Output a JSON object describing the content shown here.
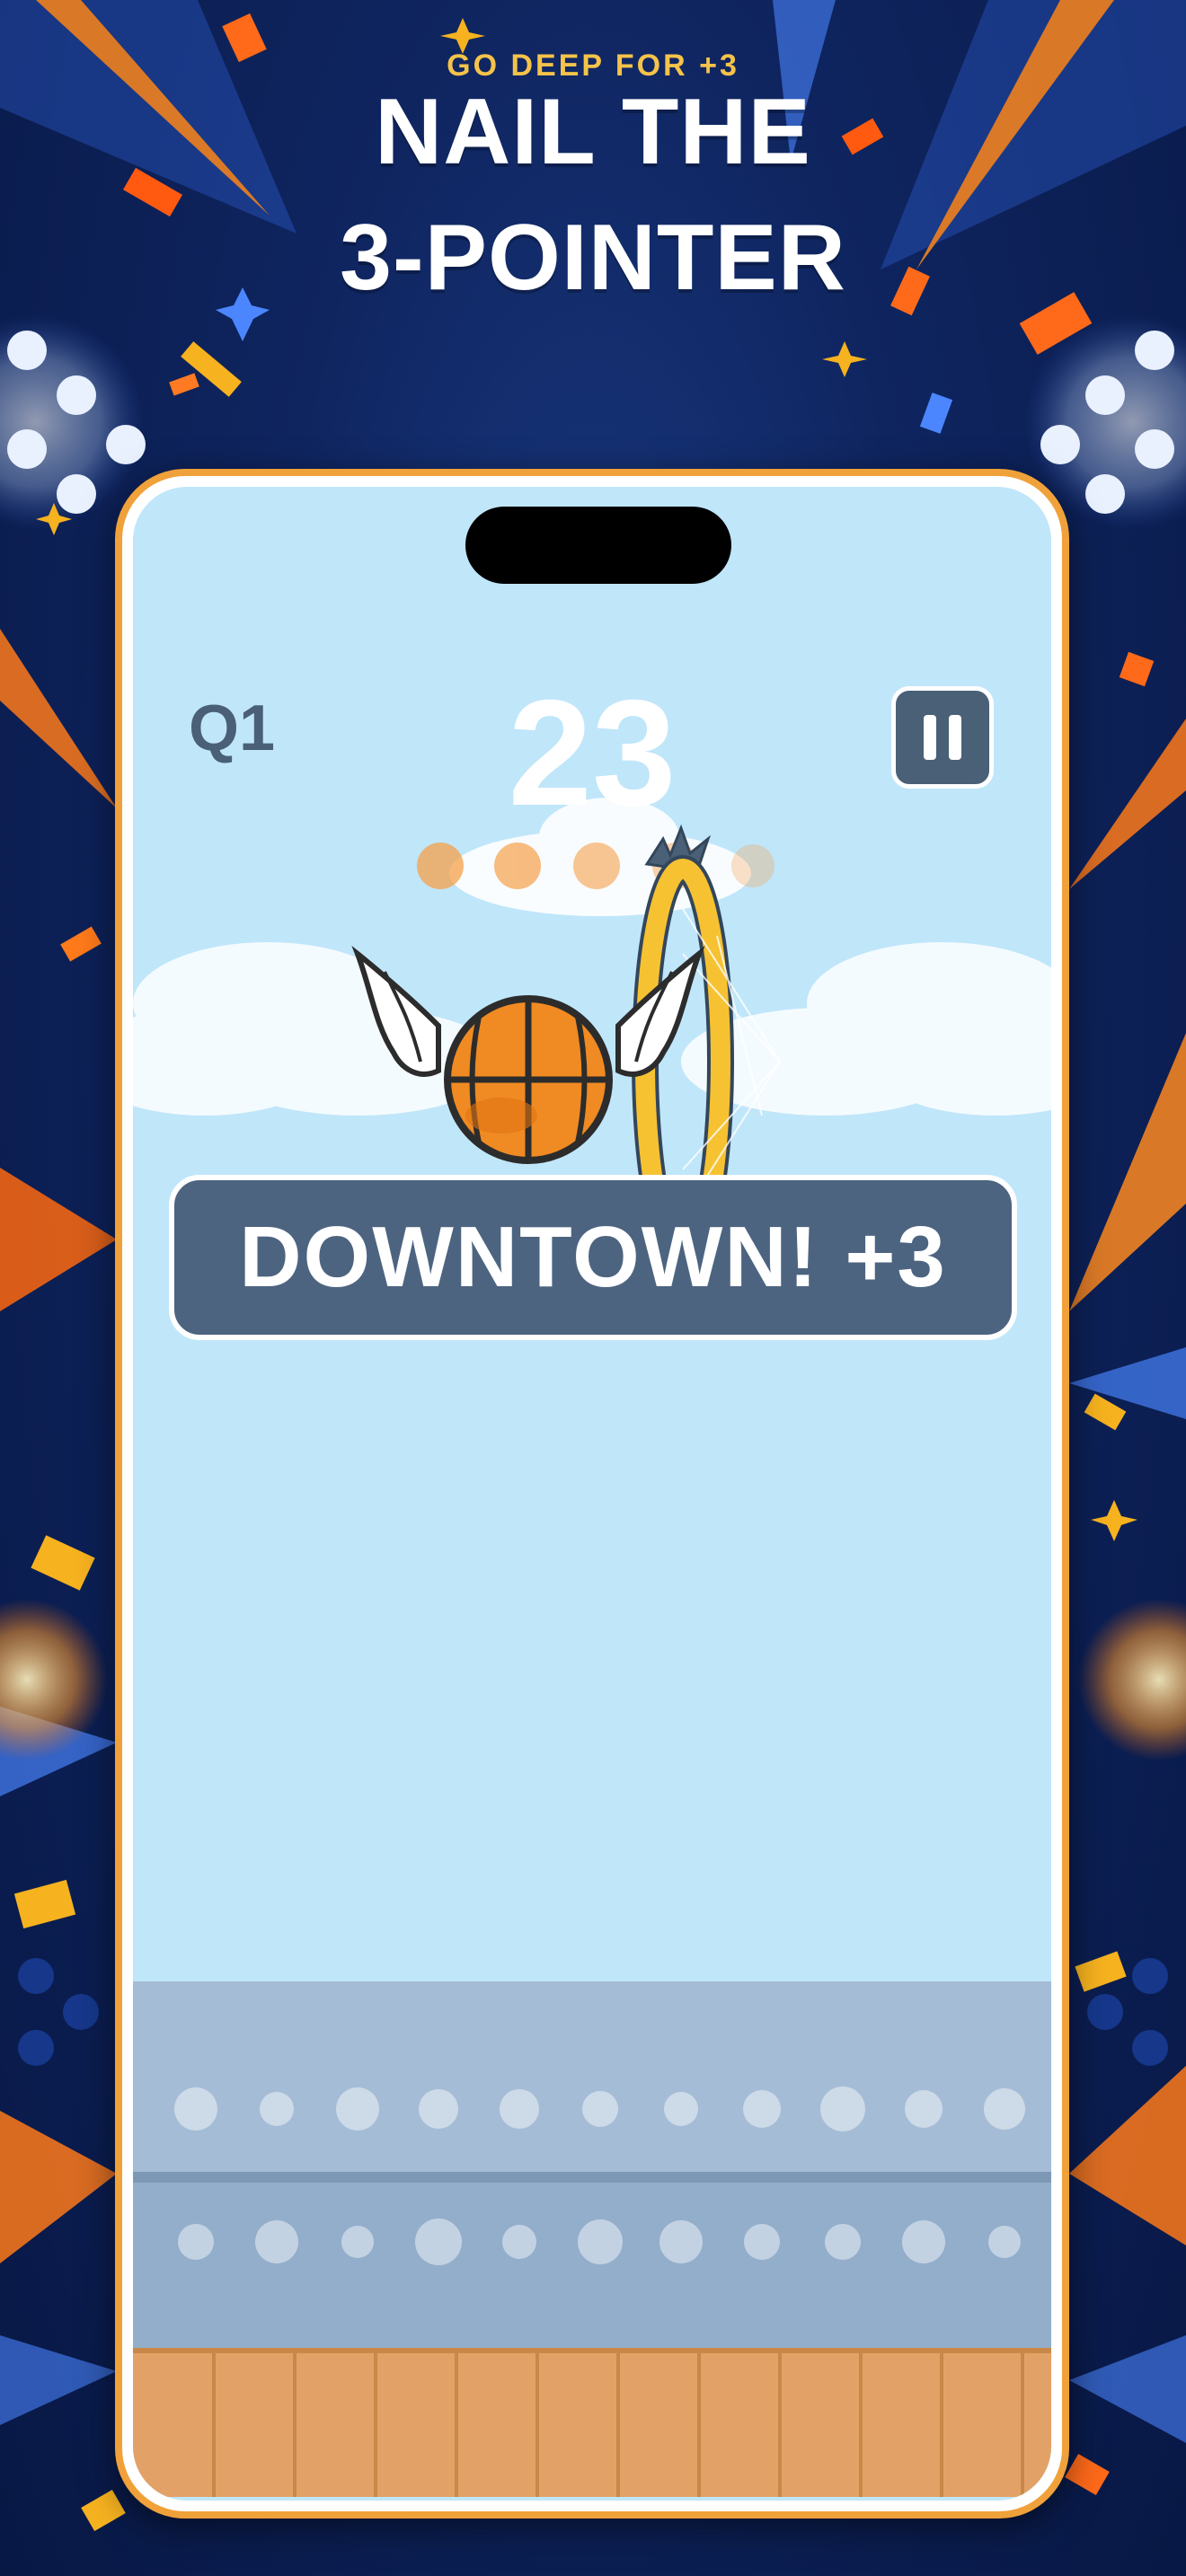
{
  "promo": {
    "tagline": "GO DEEP FOR +3",
    "title_line1": "NAIL THE",
    "title_line2": "3-POINTER"
  },
  "hud": {
    "quarter": "Q1",
    "score": "23",
    "pause_icon": "pause-icon"
  },
  "banner": {
    "text": "DOWNTOWN! +3"
  },
  "colors": {
    "sky": "#c0e6fa",
    "hud_dark": "#4a6077",
    "banner_bg": "#4d6480",
    "hoop": "#f6c232",
    "ball": "#f08a22",
    "court": "#e2a267",
    "phone_frame": "#f0a13a"
  }
}
